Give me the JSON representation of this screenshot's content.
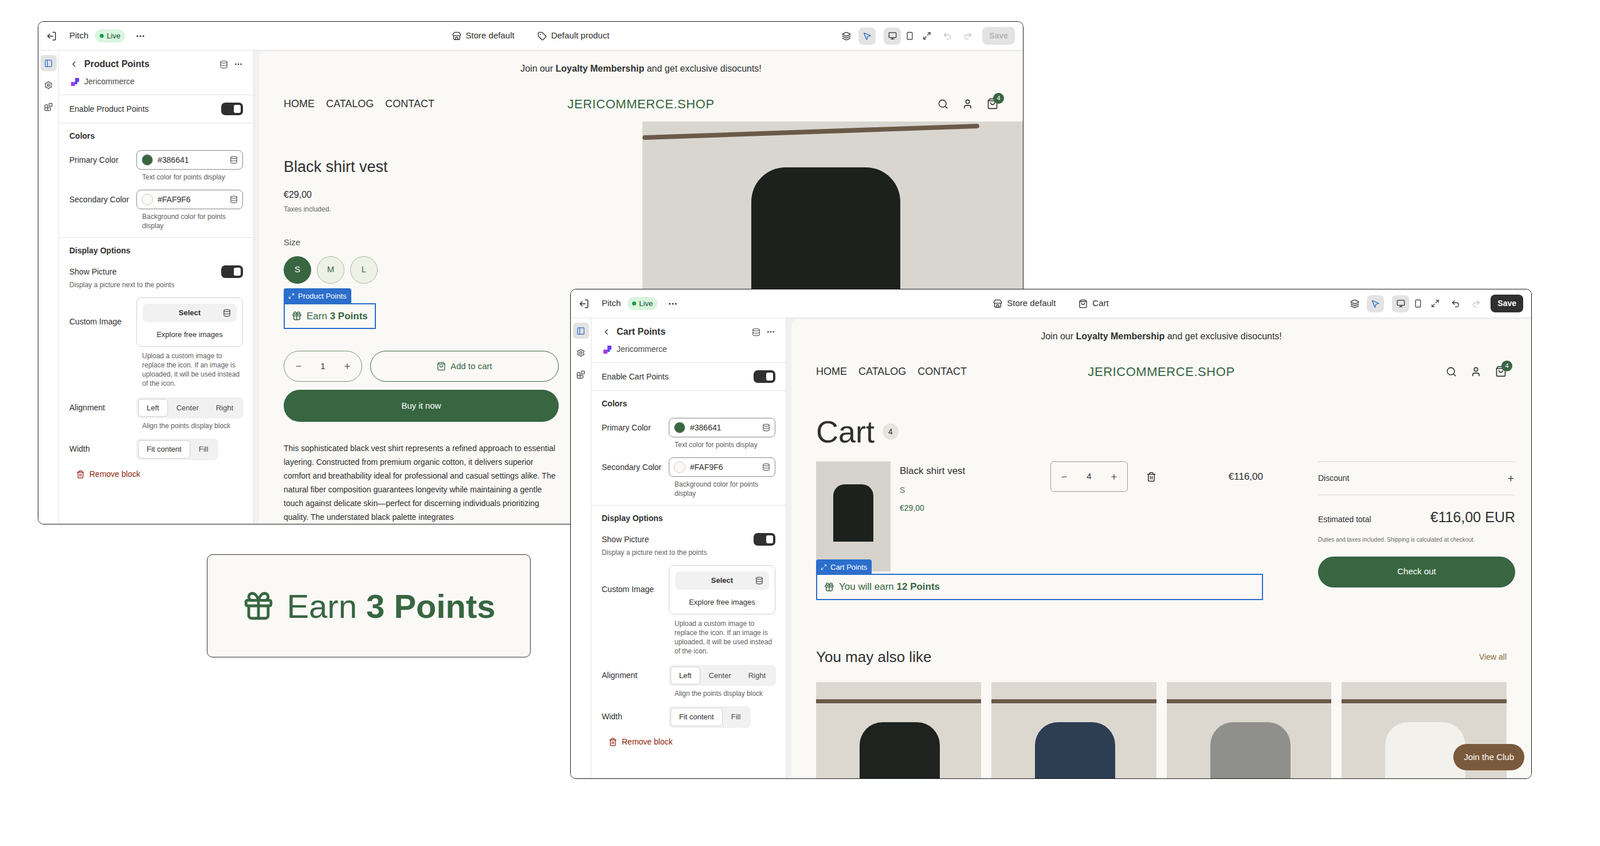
{
  "editors": [
    {
      "topbar": {
        "app": "Pitch",
        "status": "Live",
        "store": "Store default",
        "template": "Default product",
        "inspector_on": true,
        "devices": [
          {
            "selected": true
          },
          {
            "selected": false
          },
          {
            "selected": false
          }
        ],
        "undo_enabled": false,
        "redo_enabled": false,
        "save": {
          "label": "Save",
          "disabled": true
        }
      },
      "rail": [
        {
          "selected": true
        },
        {
          "selected": false
        },
        {
          "selected": false
        }
      ],
      "sidebar": {
        "title": "Product Points",
        "app": "Jericommerce",
        "enable": {
          "label": "Enable Product Points",
          "on": true
        },
        "colors_heading": "Colors",
        "colors": [
          {
            "label": "Primary Color",
            "value": "#386641",
            "help": "Text color for points display"
          },
          {
            "label": "Secondary Color",
            "value": "#FAF9F6",
            "help": "Background color for points display"
          }
        ],
        "display_heading": "Display Options",
        "show_picture": {
          "label": "Show Picture",
          "on": true,
          "help": "Display a picture next to the points"
        },
        "custom_image": {
          "label": "Custom Image",
          "button": "Select",
          "link": "Explore free images",
          "help": "Upload a custom image to replace the icon. If an image is uploaded, it will be used instead of the icon."
        },
        "alignment": {
          "label": "Alignment",
          "options": [
            {
              "label": "Left",
              "selected": true
            },
            {
              "label": "Center",
              "selected": false
            },
            {
              "label": "Right",
              "selected": false
            }
          ],
          "help": "Align the points display block"
        },
        "width": {
          "label": "Width",
          "options": [
            {
              "label": "Fit content",
              "selected": true
            },
            {
              "label": "Fill",
              "selected": false
            }
          ]
        },
        "remove": "Remove block"
      },
      "preview": {
        "kind": "product",
        "announcement": {
          "before": "Join our ",
          "bold": "Loyalty Membership",
          "after": " and get exclusive disocunts!"
        },
        "nav": [
          "HOME",
          "CATALOG",
          "CONTACT"
        ],
        "logo": "JERICOMMERCE.SHOP",
        "cart_count": "4",
        "title": "Black shirt vest",
        "price": "€29,00",
        "tax": "Taxes included.",
        "size_label": "Size",
        "sizes": [
          {
            "label": "S",
            "selected": true
          },
          {
            "label": "M",
            "selected": false
          },
          {
            "label": "L",
            "selected": false
          }
        ],
        "block_tag": "Product Points",
        "points": {
          "prefix": "Earn ",
          "value": "3 Points"
        },
        "quantity": "1",
        "add_to_cart": "Add to cart",
        "buy_now": "Buy it now",
        "description": "This sophisticated black vest shirt represents a refined approach to essential layering. Constructed from premium organic cotton, it delivers superior comfort and breathability ideal for professional and casual settings alike. The natural fiber composition guarantees longevity while maintaining a gentle touch against delicate skin—perfect for discerning individuals prioritizing quality. The understated black palette integrates"
      }
    },
    {
      "topbar": {
        "app": "Pitch",
        "status": "Live",
        "store": "Store default",
        "template": "Cart",
        "inspector_on": true,
        "devices": [
          {
            "selected": true
          },
          {
            "selected": false
          },
          {
            "selected": false
          }
        ],
        "undo_enabled": true,
        "redo_enabled": false,
        "save": {
          "label": "Save",
          "disabled": false
        }
      },
      "rail": [
        {
          "selected": true
        },
        {
          "selected": false
        },
        {
          "selected": false
        }
      ],
      "sidebar": {
        "title": "Cart Points",
        "app": "Jericommerce",
        "enable": {
          "label": "Enable Cart Points",
          "on": true
        },
        "colors_heading": "Colors",
        "colors": [
          {
            "label": "Primary Color",
            "value": "#386641",
            "help": "Text color for points display"
          },
          {
            "label": "Secondary Color",
            "value": "#FAF9F6",
            "help": "Background color for points display"
          }
        ],
        "display_heading": "Display Options",
        "show_picture": {
          "label": "Show Picture",
          "on": true,
          "help": "Display a picture next to the points"
        },
        "custom_image": {
          "label": "Custom Image",
          "button": "Select",
          "link": "Explore free images",
          "help": "Upload a custom image to replace the icon. If an image is uploaded, it will be used instead of the icon."
        },
        "alignment": {
          "label": "Alignment",
          "options": [
            {
              "label": "Left",
              "selected": true
            },
            {
              "label": "Center",
              "selected": false
            },
            {
              "label": "Right",
              "selected": false
            }
          ],
          "help": "Align the points display block"
        },
        "width": {
          "label": "Width",
          "options": [
            {
              "label": "Fit content",
              "selected": true
            },
            {
              "label": "Fill",
              "selected": false
            }
          ]
        },
        "remove": "Remove block"
      },
      "preview": {
        "kind": "cart",
        "announcement": {
          "before": "Join our ",
          "bold": "Loyalty Membership",
          "after": " and get exclusive disocunts!"
        },
        "nav": [
          "HOME",
          "CATALOG",
          "CONTACT"
        ],
        "logo": "JERICOMMERCE.SHOP",
        "cart_count": "4",
        "heading": "Cart",
        "count": "4",
        "item": {
          "name": "Black shirt vest",
          "variant": "S",
          "price": "€29,00",
          "quantity": "4",
          "total": "€116,00"
        },
        "block_tag": "Cart Points",
        "points": {
          "prefix": "You will earn ",
          "value": "12 Points"
        },
        "summary": {
          "discount": "Discount",
          "total_label": "Estimated total",
          "total": "€116,00 EUR",
          "note": "Duties and taxes included. Shipping is calculated at checkout.",
          "checkout": "Check out"
        },
        "related": {
          "heading": "You may also like",
          "link": "View all",
          "products": [
            {
              "color": "#1e2320"
            },
            {
              "color": "#2d3e52"
            },
            {
              "color": "#8f8f8c"
            },
            {
              "color": "#f3f1ec"
            }
          ]
        },
        "club": "Join the Club"
      }
    }
  ],
  "callout": {
    "prefix": "Earn ",
    "value": "3 Points"
  }
}
